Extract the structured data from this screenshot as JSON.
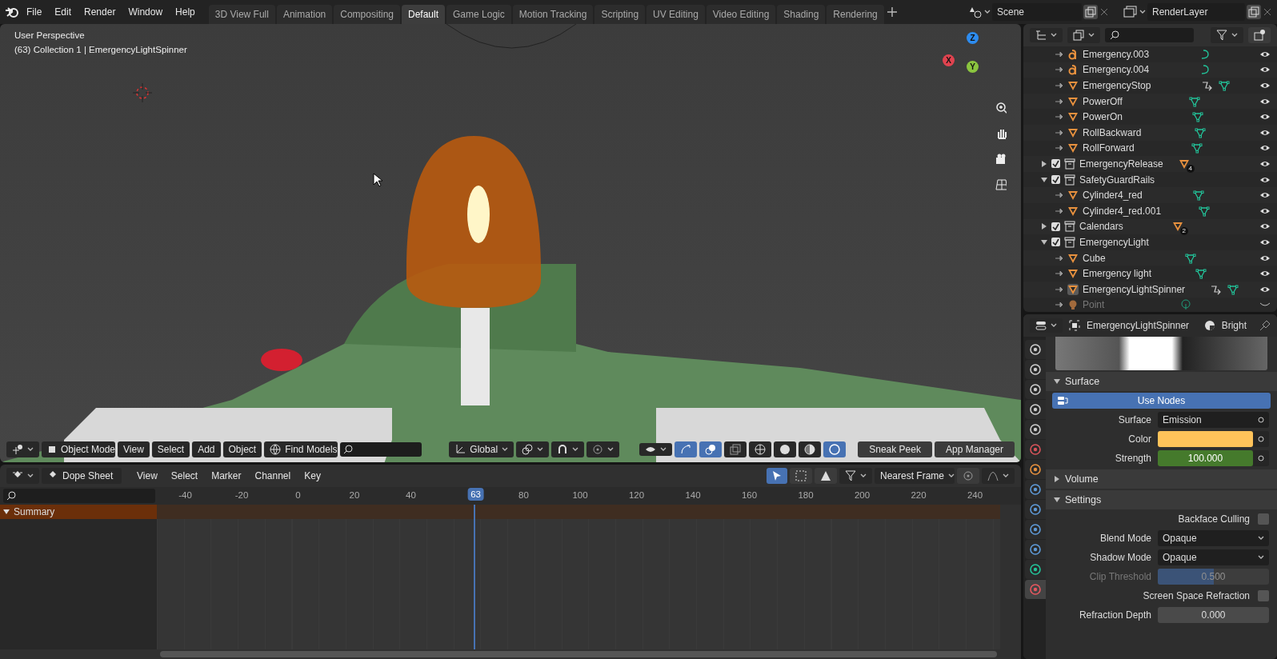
{
  "top_bar": {
    "menus": [
      "File",
      "Edit",
      "Render",
      "Window",
      "Help"
    ],
    "workspaces": [
      {
        "label": "3D View Full",
        "selected": false
      },
      {
        "label": "Animation",
        "selected": false
      },
      {
        "label": "Compositing",
        "selected": false
      },
      {
        "label": "Default",
        "selected": true
      },
      {
        "label": "Game Logic",
        "selected": false
      },
      {
        "label": "Motion Tracking",
        "selected": false
      },
      {
        "label": "Scripting",
        "selected": false
      },
      {
        "label": "UV Editing",
        "selected": false
      },
      {
        "label": "Video Editing",
        "selected": false
      },
      {
        "label": "Shading",
        "selected": false
      },
      {
        "label": "Rendering",
        "selected": false
      }
    ],
    "scene": "Scene",
    "view_layer": "RenderLayer"
  },
  "viewport": {
    "overlay_lines": [
      "User Perspective",
      "(63) Collection 1 | EmergencyLightSpinner"
    ],
    "gizmo_axes": [
      {
        "label": "Z",
        "color": "#2d8cf0"
      },
      {
        "label": "Y",
        "color": "#8bc53f"
      },
      {
        "label": "X",
        "color": "#e0434f"
      }
    ],
    "header": {
      "mode": "Object Mode",
      "menus": [
        "View",
        "Select",
        "Add",
        "Object"
      ],
      "find_models": "Find Models",
      "orientation": "Global",
      "buttons": [
        "Sneak Peek",
        "App Manager"
      ]
    }
  },
  "dope_sheet": {
    "editor": "Dope Sheet",
    "menus": [
      "View",
      "Select",
      "Marker",
      "Channel",
      "Key"
    ],
    "snap": "Nearest Frame",
    "ticks": [
      "-40",
      "-20",
      "0",
      "20",
      "40",
      "80",
      "100",
      "120",
      "140",
      "160",
      "180",
      "200",
      "220",
      "240"
    ],
    "current_frame": "63",
    "channels": [
      {
        "name": "Summary",
        "expanded": true
      }
    ]
  },
  "outliner": {
    "continued_children": [
      {
        "name": "Emergency.003",
        "kind": "text",
        "constraint": false,
        "selected": false,
        "visible": true
      },
      {
        "name": "Emergency.004",
        "kind": "text",
        "constraint": false,
        "selected": false,
        "visible": true
      },
      {
        "name": "EmergencyStop",
        "kind": "mesh",
        "constraint": true,
        "selected": false,
        "visible": true
      },
      {
        "name": "PowerOff",
        "kind": "mesh",
        "constraint": false,
        "selected": false,
        "visible": true
      },
      {
        "name": "PowerOn",
        "kind": "mesh",
        "constraint": false,
        "selected": false,
        "visible": true
      },
      {
        "name": "RollBackward",
        "kind": "mesh",
        "constraint": false,
        "selected": false,
        "visible": true
      },
      {
        "name": "RollForward",
        "kind": "mesh",
        "constraint": false,
        "selected": false,
        "visible": true
      }
    ],
    "collections": [
      {
        "name": "EmergencyRelease",
        "checked": true,
        "expanded": false,
        "badge": "4"
      },
      {
        "name": "SafetyGuardRails",
        "checked": true,
        "expanded": true,
        "children": [
          {
            "name": "Cylinder4_red",
            "kind": "mesh",
            "constraint": false,
            "selected": false,
            "visible": true
          },
          {
            "name": "Cylinder4_red.001",
            "kind": "mesh",
            "constraint": false,
            "selected": false,
            "visible": true
          }
        ]
      },
      {
        "name": "Calendars",
        "checked": true,
        "expanded": false,
        "badge": "2"
      },
      {
        "name": "EmergencyLight",
        "checked": true,
        "expanded": true,
        "children": [
          {
            "name": "Cube",
            "kind": "mesh",
            "constraint": false,
            "selected": false,
            "visible": true
          },
          {
            "name": "Emergency light",
            "kind": "mesh",
            "constraint": false,
            "selected": false,
            "visible": true
          },
          {
            "name": "EmergencyLightSpinner",
            "kind": "mesh",
            "constraint": true,
            "selected": true,
            "visible": true
          },
          {
            "name": "Point",
            "kind": "light",
            "constraint": false,
            "selected": false,
            "visible": false
          }
        ]
      }
    ]
  },
  "properties": {
    "object": "EmergencyLightSpinner",
    "material": "Bright",
    "tabs": [
      {
        "kind": "tool",
        "selected": false
      },
      {
        "kind": "render",
        "selected": false
      },
      {
        "kind": "output",
        "selected": false
      },
      {
        "kind": "view_layer",
        "selected": false
      },
      {
        "kind": "scene",
        "selected": false
      },
      {
        "kind": "world",
        "selected": false
      },
      {
        "kind": "object",
        "selected": false
      },
      {
        "kind": "modifiers",
        "selected": false
      },
      {
        "kind": "particles",
        "selected": false
      },
      {
        "kind": "physics",
        "selected": false
      },
      {
        "kind": "constraints",
        "selected": false
      },
      {
        "kind": "data",
        "selected": false
      },
      {
        "kind": "material",
        "selected": true
      }
    ],
    "sections": [
      {
        "title": "Surface",
        "expanded": true,
        "rows": [
          {
            "kind": "button",
            "label": "Use Nodes"
          },
          {
            "kind": "menu",
            "label": "Surface",
            "value": "Emission"
          },
          {
            "kind": "color",
            "label": "Color",
            "color": "#ffc35a"
          },
          {
            "kind": "number",
            "label": "Strength",
            "value": "100.000"
          }
        ]
      },
      {
        "title": "Volume",
        "expanded": false
      },
      {
        "title": "Settings",
        "expanded": true,
        "rows": [
          {
            "kind": "checkbox",
            "label": "Backface Culling",
            "checked": false
          },
          {
            "kind": "dropdown",
            "label": "Blend Mode",
            "value": "Opaque"
          },
          {
            "kind": "dropdown",
            "label": "Shadow Mode",
            "value": "Opaque"
          },
          {
            "kind": "slider",
            "label": "Clip Threshold",
            "value": "0.500",
            "level": 0.5,
            "disabled": true
          },
          {
            "kind": "checkbox",
            "label": "Screen Space Refraction",
            "checked": false
          },
          {
            "kind": "slider",
            "label": "Refraction Depth",
            "value": "0.000",
            "level": 0,
            "disabled": false
          }
        ]
      }
    ]
  }
}
